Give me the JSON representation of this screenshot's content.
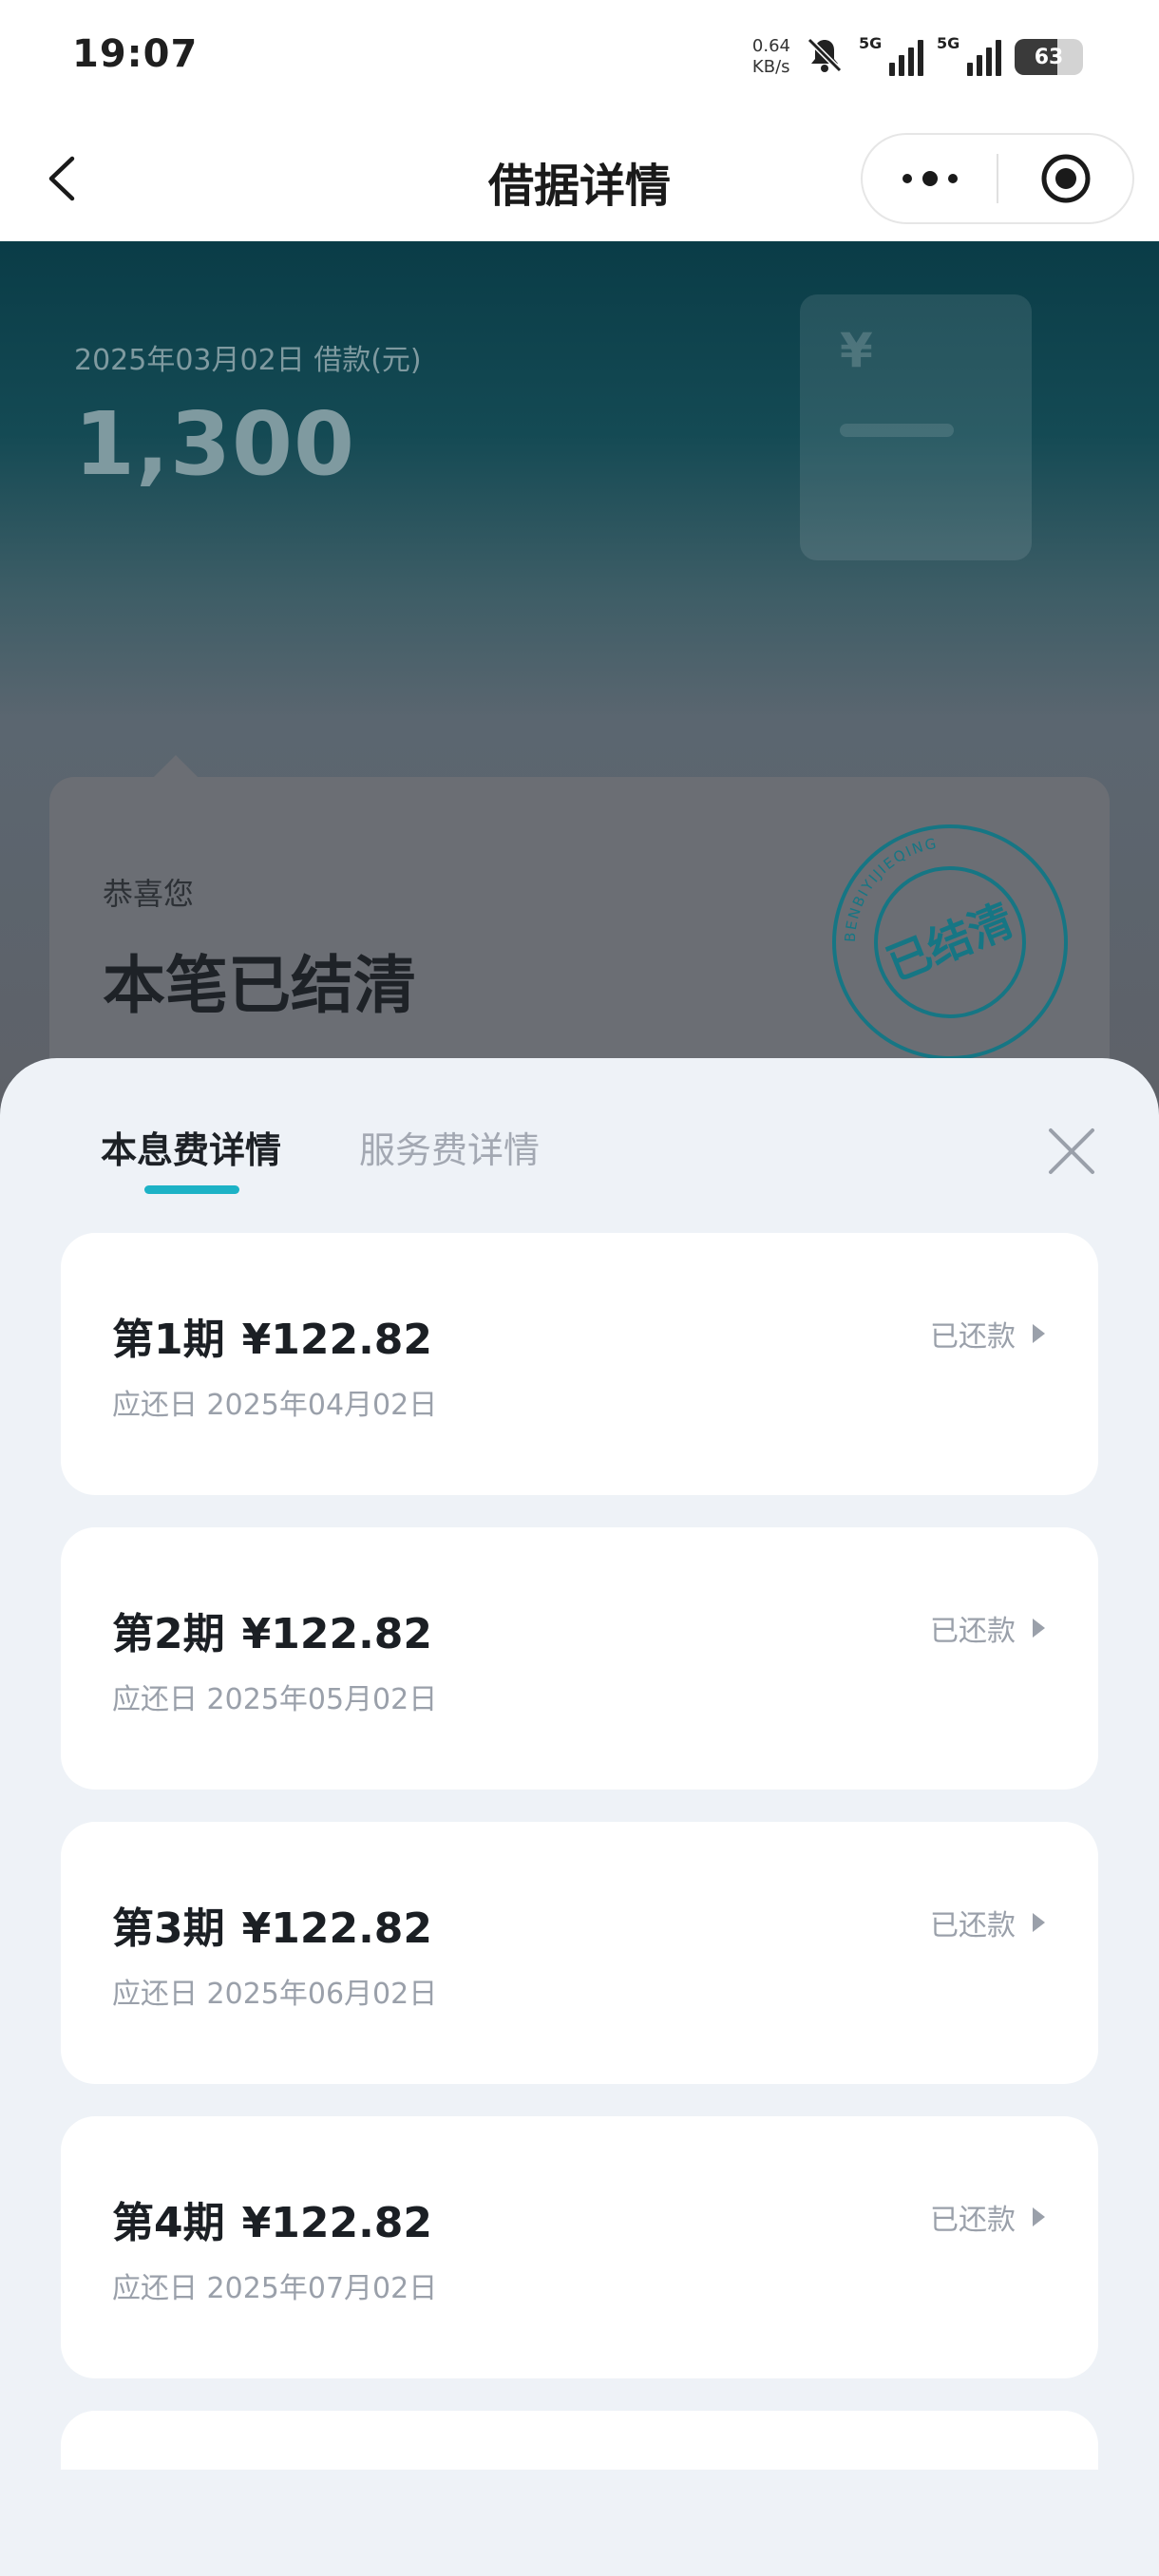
{
  "status_bar": {
    "time": "19:07",
    "net_speed_value": "0.64",
    "net_speed_unit": "KB/s",
    "sim1_tag": "5G",
    "sim2_tag": "5G",
    "battery": "63",
    "icons": [
      "bell-muted-icon",
      "signal-icon",
      "signal-icon",
      "battery-icon"
    ]
  },
  "nav": {
    "title": "借据详情",
    "icons": [
      "back-icon",
      "more-icon",
      "miniprogram-close-icon"
    ]
  },
  "loan": {
    "date_label": "2025年03月02日 借款(元)",
    "amount": "1,300",
    "congrats": "恭喜您",
    "settled_title": "本笔已结清",
    "stamp_text": "已结清",
    "stamp_ring_text": "BENBIYIJIEQING"
  },
  "tabs": {
    "items": [
      {
        "label": "本息费详情",
        "active": true
      },
      {
        "label": "服务费详情",
        "active": false
      }
    ],
    "accent_color": "#1cb2c6"
  },
  "sheet": {
    "close_icon": "close-icon",
    "periods": [
      {
        "title": "第1期",
        "amount": "¥122.82",
        "due": "应还日 2025年04月02日",
        "status": "已还款"
      },
      {
        "title": "第2期",
        "amount": "¥122.82",
        "due": "应还日 2025年05月02日",
        "status": "已还款"
      },
      {
        "title": "第3期",
        "amount": "¥122.82",
        "due": "应还日 2025年06月02日",
        "status": "已还款"
      },
      {
        "title": "第4期",
        "amount": "¥122.82",
        "due": "应还日 2025年07月02日",
        "status": "已还款"
      }
    ]
  }
}
